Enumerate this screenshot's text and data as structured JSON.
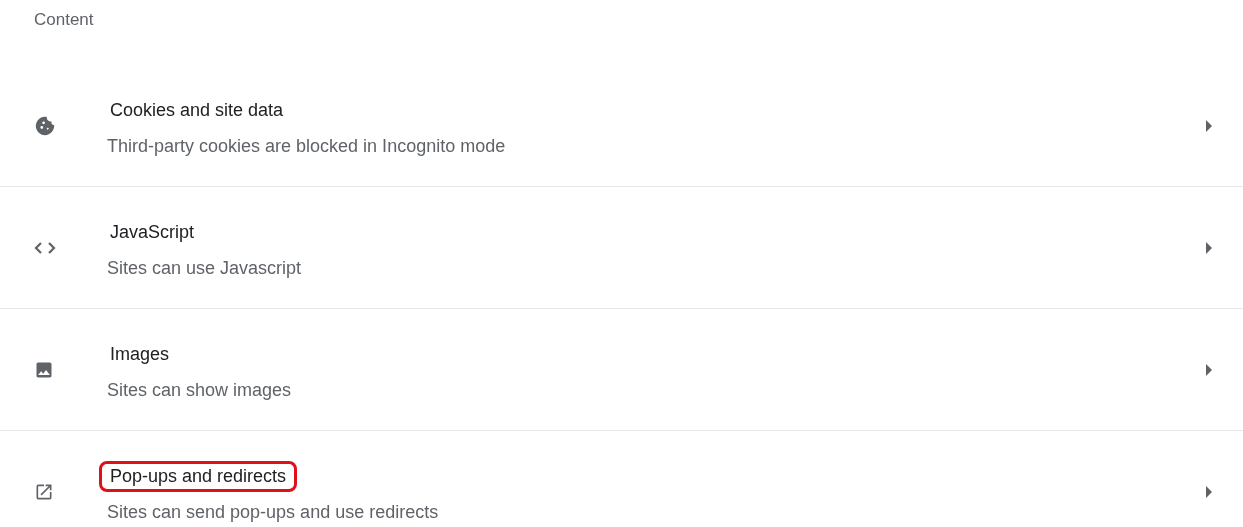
{
  "section_title": "Content",
  "rows": [
    {
      "title": "Cookies and site data",
      "subtitle": "Third-party cookies are blocked in Incognito mode",
      "highlighted": false
    },
    {
      "title": "JavaScript",
      "subtitle": "Sites can use Javascript",
      "highlighted": false
    },
    {
      "title": "Images",
      "subtitle": "Sites can show images",
      "highlighted": false
    },
    {
      "title": "Pop-ups and redirects",
      "subtitle": "Sites can send pop-ups and use redirects",
      "highlighted": true
    }
  ]
}
